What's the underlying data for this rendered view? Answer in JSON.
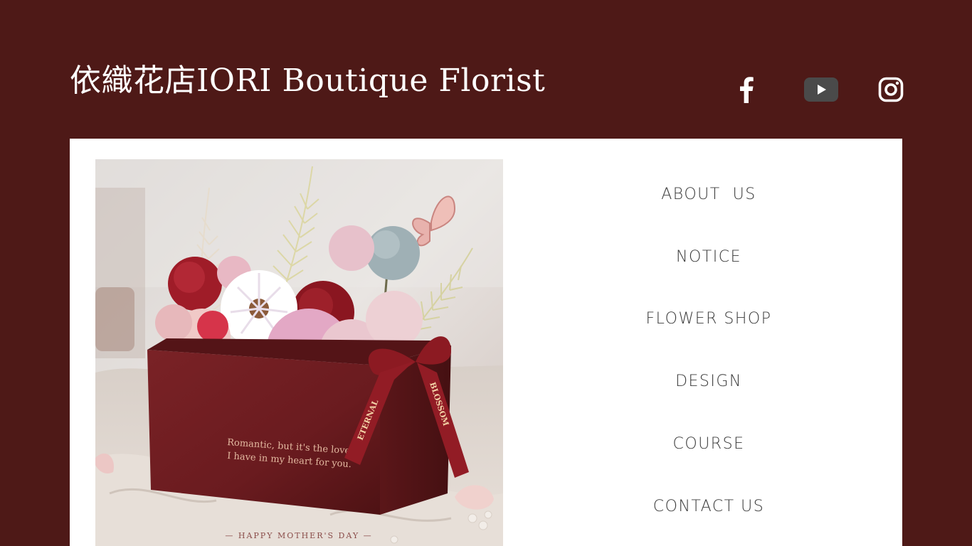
{
  "header": {
    "title": "依織花店IORI Boutique Florist"
  },
  "social": {
    "facebook_icon": "facebook-icon",
    "youtube_icon": "youtube-icon",
    "instagram_icon": "instagram-icon"
  },
  "hero": {
    "box_line_1": "Romantic, but it's the love",
    "box_line_2": "I have in my heart for you.",
    "ribbon_text_1": "ETERNAL",
    "ribbon_text_2": "BLOSSOM",
    "caption": "— HAPPY MOTHER'S DAY —"
  },
  "nav": {
    "items": [
      {
        "label": "ABOUT  US"
      },
      {
        "label": "NOTICE"
      },
      {
        "label": "FLOWER SHOP"
      },
      {
        "label": "DESIGN"
      },
      {
        "label": "COURSE"
      },
      {
        "label": "CONTACT US"
      }
    ]
  },
  "colors": {
    "background": "#4e1917",
    "card": "#ffffff",
    "nav_text": "#3a3a3a",
    "box": "#6e1a1c"
  }
}
